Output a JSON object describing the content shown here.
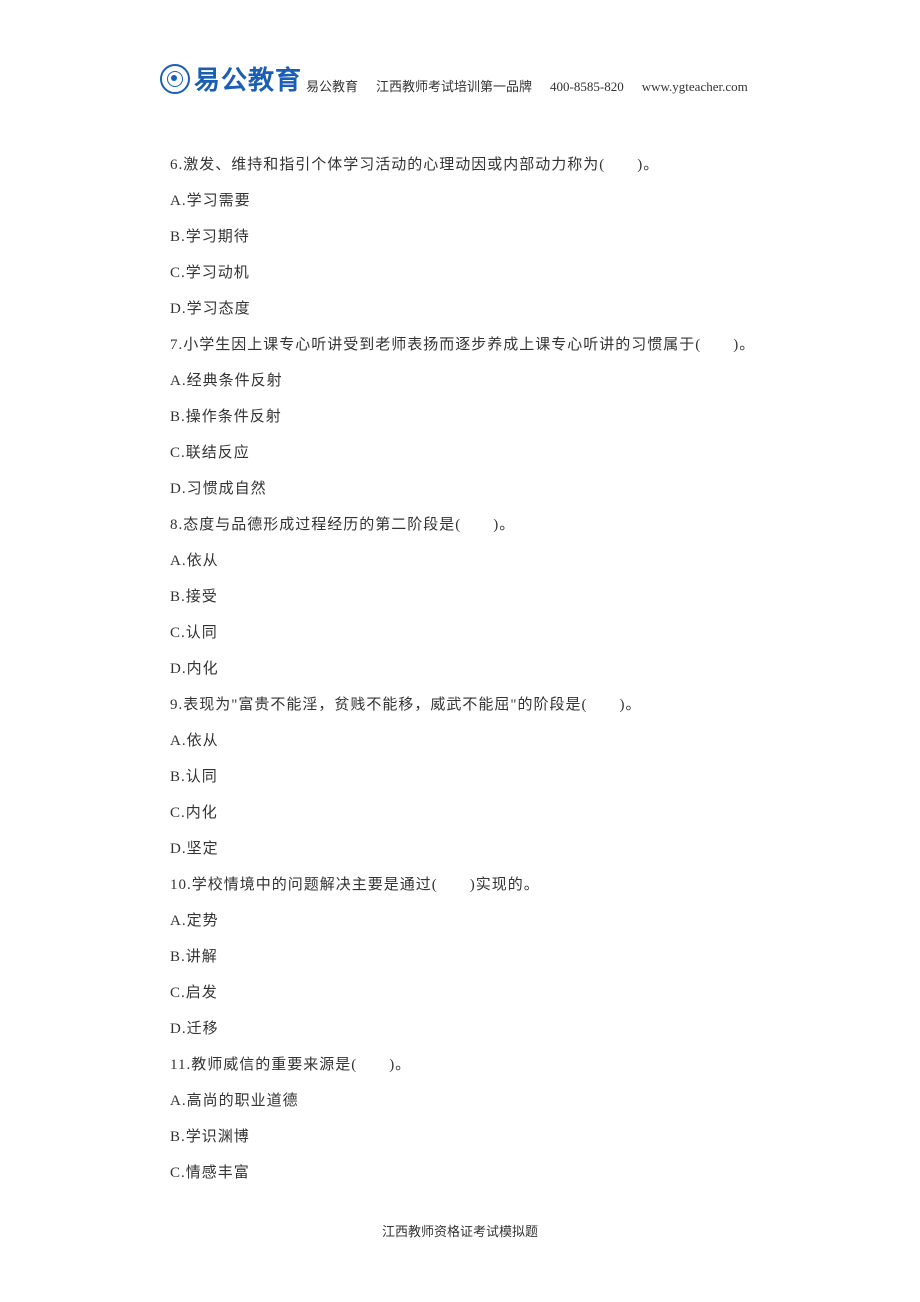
{
  "header": {
    "logo_text": "易公教育",
    "company": "易公教育",
    "slogan": "江西教师考试培训第一品牌",
    "phone": "400-8585-820",
    "website": "www.ygteacher.com"
  },
  "questions": [
    {
      "stem": "6.激发、维持和指引个体学习活动的心理动因或内部动力称为(　　)。",
      "options": [
        "A.学习需要",
        "B.学习期待",
        "C.学习动机",
        "D.学习态度"
      ]
    },
    {
      "stem": "7.小学生因上课专心听讲受到老师表扬而逐步养成上课专心听讲的习惯属于(　　)。",
      "options": [
        "A.经典条件反射",
        "B.操作条件反射",
        "C.联结反应",
        "D.习惯成自然"
      ]
    },
    {
      "stem": "8.态度与品德形成过程经历的第二阶段是(　　)。",
      "options": [
        "A.依从",
        "B.接受",
        "C.认同",
        "D.内化"
      ]
    },
    {
      "stem": "9.表现为\"富贵不能淫，贫贱不能移，威武不能屈\"的阶段是(　　)。",
      "options": [
        "A.依从",
        "B.认同",
        "C.内化",
        "D.坚定"
      ]
    },
    {
      "stem": "10.学校情境中的问题解决主要是通过(　　)实现的。",
      "options": [
        "A.定势",
        "B.讲解",
        "C.启发",
        "D.迁移"
      ]
    },
    {
      "stem": "11.教师威信的重要来源是(　　)。",
      "options": [
        "A.高尚的职业道德",
        "B.学识渊博",
        "C.情感丰富"
      ]
    }
  ],
  "footer": "江西教师资格证考试模拟题"
}
